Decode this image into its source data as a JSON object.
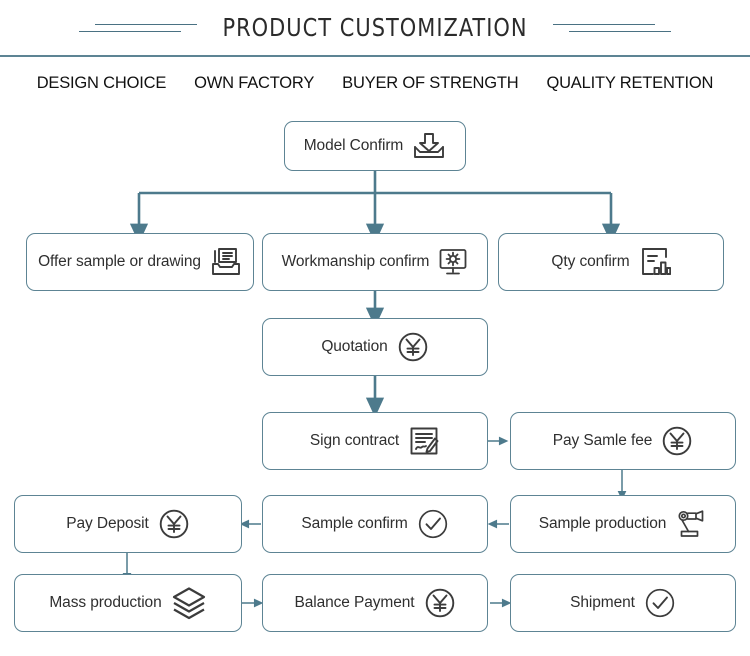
{
  "header": {
    "title": "PRODUCT CUSTOMIZATION",
    "divider_color": "#5d8494",
    "subtitles": [
      "DESIGN CHOICE",
      "OWN FACTORY",
      "BUYER OF STRENGTH",
      "QUALITY RETENTION"
    ]
  },
  "theme": {
    "accent": "#5d8494",
    "icon_color": "#3c3c3c",
    "text": "#2f2f2f",
    "background": "#ffffff"
  },
  "flow": {
    "nodes": [
      {
        "id": "model-confirm",
        "label": "Model Confirm",
        "icon": "download-tray-icon"
      },
      {
        "id": "offer-sample",
        "label": "Offer sample or drawing",
        "icon": "document-tray-icon"
      },
      {
        "id": "workmanship",
        "label": "Workmanship confirm",
        "icon": "monitor-gear-icon"
      },
      {
        "id": "qty-confirm",
        "label": "Qty confirm",
        "icon": "report-chart-icon"
      },
      {
        "id": "quotation",
        "label": "Quotation",
        "icon": "yen-circle-icon"
      },
      {
        "id": "sign-contract",
        "label": "Sign contract",
        "icon": "signed-document-icon"
      },
      {
        "id": "pay-sample-fee",
        "label": "Pay Samle fee",
        "icon": "yen-circle-icon"
      },
      {
        "id": "sample-production",
        "label": "Sample production",
        "icon": "robot-arm-icon"
      },
      {
        "id": "sample-confirm",
        "label": "Sample confirm",
        "icon": "check-circle-icon"
      },
      {
        "id": "pay-deposit",
        "label": "Pay Deposit",
        "icon": "yen-circle-icon"
      },
      {
        "id": "mass-production",
        "label": "Mass production",
        "icon": "layers-stack-icon"
      },
      {
        "id": "balance-payment",
        "label": "Balance Payment",
        "icon": "yen-circle-icon"
      },
      {
        "id": "shipment",
        "label": "Shipment",
        "icon": "check-circle-icon"
      }
    ]
  }
}
